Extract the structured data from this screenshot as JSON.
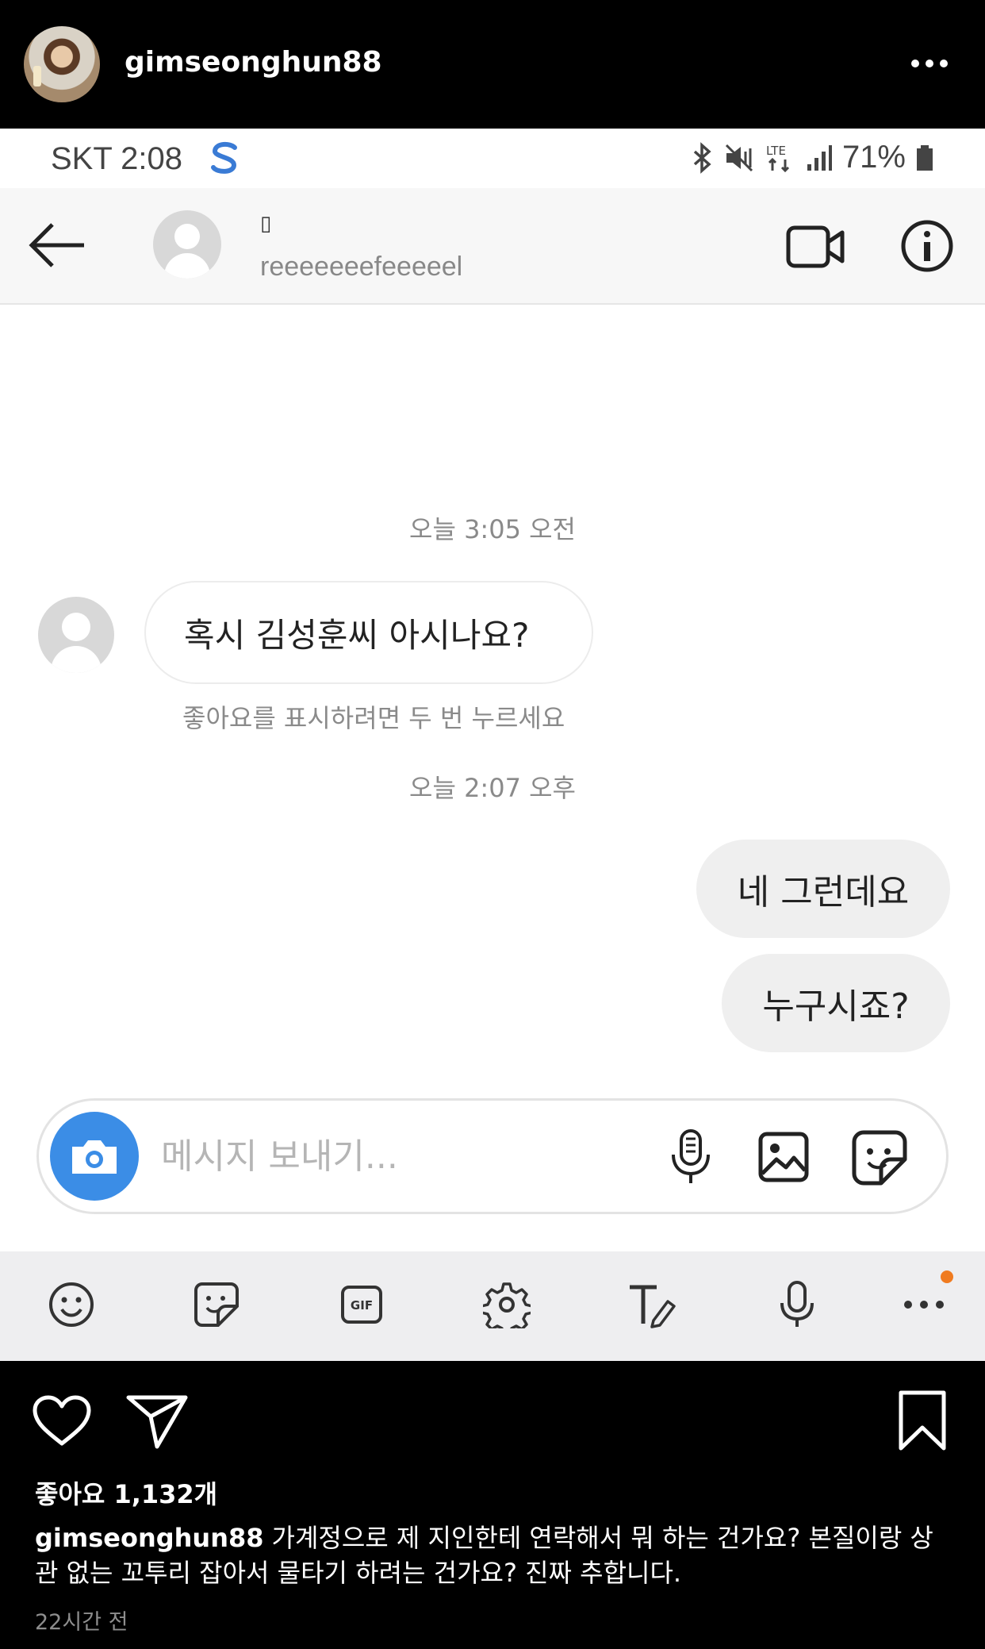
{
  "post": {
    "username": "gimseonghun88",
    "likes_text": "좋아요 1,132개",
    "caption_username": "gimseonghun88",
    "caption_text": "가계정으로 제 지인한테 연락해서 뭐 하는 건가요? 본질이랑 상관 없는 꼬투리 잡아서 물타기 하려는 건가요? 진짜 추합니다.",
    "time_ago": "22시간 전"
  },
  "screenshot": {
    "status_bar": {
      "carrier_time": "SKT 2:08",
      "battery": "71%"
    },
    "dm_header": {
      "name_placeholder": "▯",
      "handle": "reeeeeeefeeeeel"
    },
    "messages": {
      "timestamp_1": "오늘 3:05 오전",
      "incoming_1": "혹시 김성훈씨 아시나요?",
      "like_hint": "좋아요를 표시하려면 두 번 누르세요",
      "timestamp_2": "오늘 2:07 오후",
      "outgoing_1": "네 그런데요",
      "outgoing_2": "누구시죠?"
    },
    "composer": {
      "placeholder": "메시지 보내기..."
    },
    "keyboard_toolbar": {
      "gif_label": "GIF"
    }
  },
  "colors": {
    "accent_blue": "#3b8de6",
    "notification_orange": "#f07b20"
  }
}
